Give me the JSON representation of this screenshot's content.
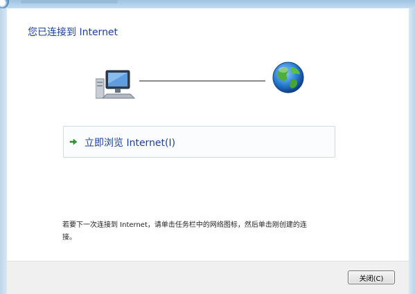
{
  "dialog": {
    "heading": "您已连接到 Internet",
    "browse_option_label": "立即浏览 Internet(I)",
    "hint_text": "若要下一次连接到 Internet，请单击任务栏中的网络图标，然后单击刚创建的连接。",
    "close_button_label": "关闭(C)"
  },
  "icons": {
    "computer": "computer-icon",
    "globe": "globe-icon",
    "arrow": "green-arrow-icon"
  },
  "colors": {
    "heading_text": "#1c3f94",
    "arrow_green": "#2e9b2e",
    "frame_blue": "#bcd5ea"
  }
}
